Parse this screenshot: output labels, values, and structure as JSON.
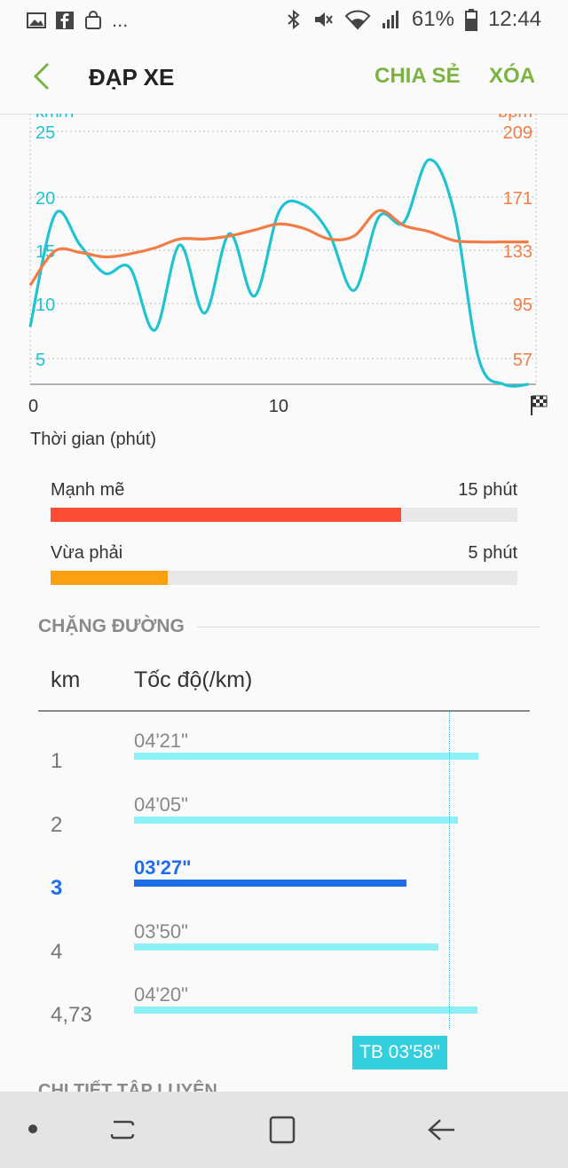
{
  "status": {
    "battery": "61%",
    "time": "12:44",
    "more": "...",
    "left_icons": [
      "gallery-icon",
      "facebook-icon",
      "shopping-bag-icon"
    ],
    "right_icons": [
      "bluetooth-icon",
      "mute-icon",
      "wifi-icon",
      "signal-icon",
      "battery-icon"
    ]
  },
  "header": {
    "title": "ĐẠP XE",
    "share": "CHIA SẺ",
    "delete": "XÓA"
  },
  "chart_data": {
    "type": "line",
    "left_axis": {
      "unit": "km/h",
      "ticks": [
        "25",
        "20",
        "15",
        "10",
        "5"
      ],
      "color": "#1fc3d2"
    },
    "right_axis": {
      "unit": "bpm",
      "ticks": [
        "209",
        "171",
        "133",
        "95",
        "57"
      ],
      "color": "#f07d45"
    },
    "x_ticks": [
      "0",
      "10"
    ],
    "xlabel": "Thời gian (phút)",
    "x_range": [
      0,
      20.3
    ],
    "grid": true,
    "series": [
      {
        "axis": "left",
        "color": "#1fc3d2",
        "points": [
          [
            0,
            7.8
          ],
          [
            1,
            17.7
          ],
          [
            2,
            15
          ],
          [
            3,
            12.5
          ],
          [
            4,
            13
          ],
          [
            5,
            7.5
          ],
          [
            6,
            15
          ],
          [
            7,
            9
          ],
          [
            8,
            16
          ],
          [
            9,
            10.5
          ],
          [
            10,
            18
          ],
          [
            11,
            18.5
          ],
          [
            12,
            16
          ],
          [
            13,
            11
          ],
          [
            14,
            17.5
          ],
          [
            15,
            17
          ],
          [
            16,
            22.5
          ],
          [
            17,
            18
          ],
          [
            18,
            5
          ],
          [
            19,
            2.5
          ],
          [
            20,
            0
          ]
        ]
      },
      {
        "axis": "right",
        "color": "#f07d45",
        "points": [
          [
            0,
            106
          ],
          [
            1,
            129
          ],
          [
            2,
            128
          ],
          [
            3,
            125
          ],
          [
            4,
            127
          ],
          [
            5,
            131
          ],
          [
            6,
            137
          ],
          [
            7,
            137
          ],
          [
            8,
            139
          ],
          [
            9,
            143
          ],
          [
            10,
            147
          ],
          [
            11,
            144
          ],
          [
            12,
            137
          ],
          [
            13,
            139
          ],
          [
            14,
            156
          ],
          [
            15,
            146
          ],
          [
            16,
            142
          ],
          [
            17,
            136
          ],
          [
            18,
            135
          ],
          [
            19,
            135
          ],
          [
            20,
            135
          ]
        ]
      }
    ]
  },
  "intensity": [
    {
      "label": "Mạnh mẽ",
      "value": "15 phút",
      "fraction": 0.75,
      "color": "#fc4c33"
    },
    {
      "label": "Vừa phải",
      "value": "5 phút",
      "fraction": 0.25,
      "color": "#fca012"
    }
  ],
  "splits": {
    "heading": "CHẶNG ĐƯỜNG",
    "col_km": "km",
    "col_pace": "Tốc độ(/km)",
    "rows": [
      {
        "km": "1",
        "pace": "04'21\"",
        "fraction": 0.88
      },
      {
        "km": "2",
        "pace": "04'05\"",
        "fraction": 0.827
      },
      {
        "km": "3",
        "pace": "03'27\"",
        "fraction": 0.697,
        "highlight": true
      },
      {
        "km": "4",
        "pace": "03'50\"",
        "fraction": 0.777
      },
      {
        "km": "4,73",
        "pace": "04'20\"",
        "fraction": 0.877
      }
    ],
    "average": "TB 03'58\""
  },
  "next_section": "CHI TIẾT TẬP LUYỆN",
  "nav": [
    "recent-apps-icon",
    "home-icon",
    "back-icon"
  ]
}
